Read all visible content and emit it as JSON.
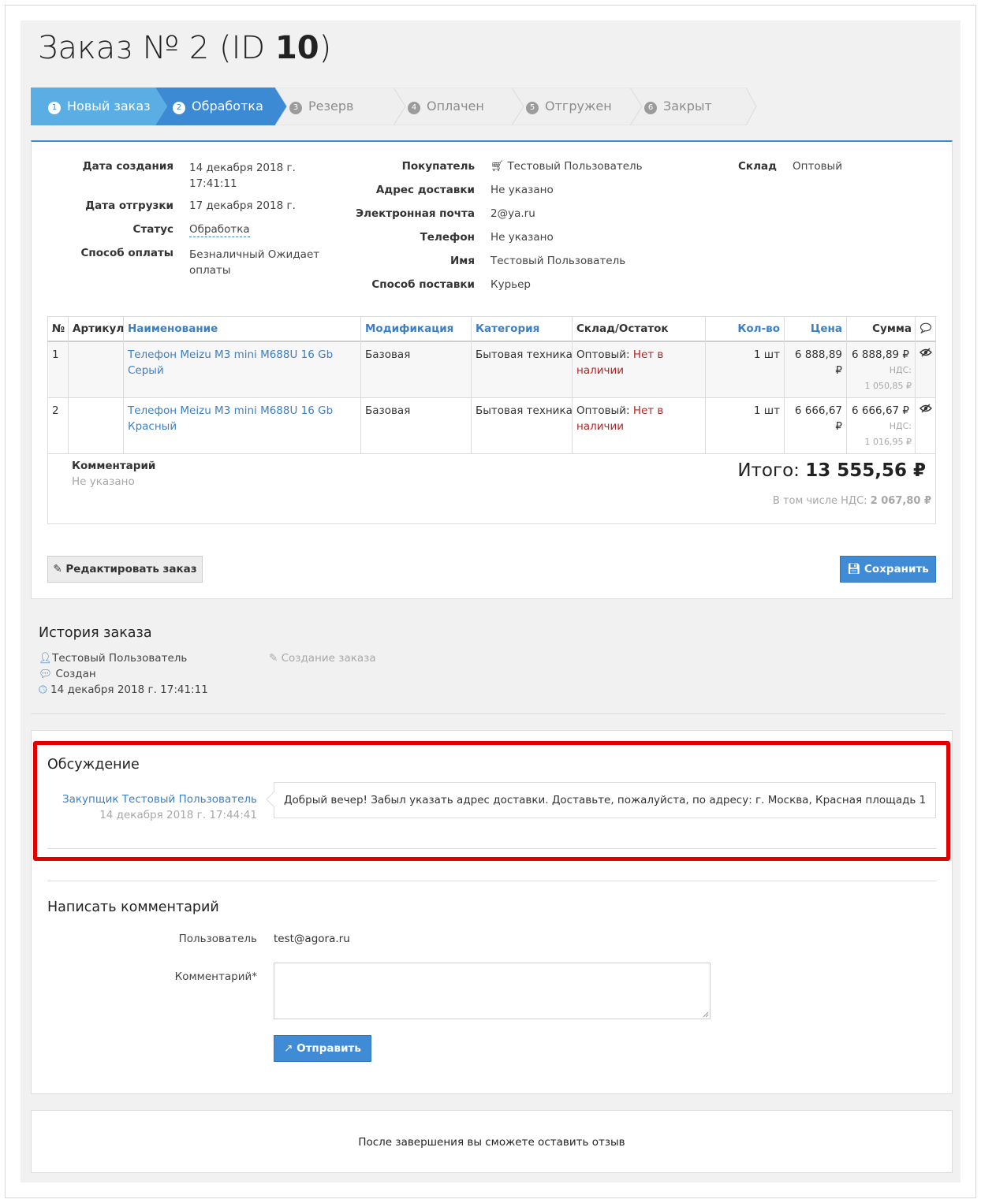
{
  "order": {
    "title_prefix": "Заказ № 2 (ID ",
    "title_id": "10",
    "title_suffix": ")"
  },
  "steps": [
    {
      "num": "1",
      "label": "Новый заказ"
    },
    {
      "num": "2",
      "label": "Обработка"
    },
    {
      "num": "3",
      "label": "Резерв"
    },
    {
      "num": "4",
      "label": "Оплачен"
    },
    {
      "num": "5",
      "label": "Отгружен"
    },
    {
      "num": "6",
      "label": "Закрыт"
    }
  ],
  "info": {
    "created_label": "Дата создания",
    "created_value_line1": "14 декабря 2018 г.",
    "created_value_line2": "17:41:11",
    "shipped_label": "Дата отгрузки",
    "shipped_value": "17 декабря 2018 г.",
    "status_label": "Статус",
    "status_value": "Обработка",
    "payment_label": "Способ оплаты",
    "payment_value_line1": "Безналичный Ожидает",
    "payment_value_line2": "оплаты",
    "buyer_label": "Покупатель",
    "buyer_value": "Тестовый Пользователь",
    "address_label": "Адрес доставки",
    "address_value": "Не указано",
    "email_label": "Электронная почта",
    "email_value": "2@ya.ru",
    "phone_label": "Телефон",
    "phone_value": "Не указано",
    "name_label": "Имя",
    "name_value": "Тестовый Пользователь",
    "delivery_label": "Способ поставки",
    "delivery_value": "Курьер",
    "warehouse_label": "Склад",
    "warehouse_value": "Оптовый"
  },
  "table": {
    "headers": {
      "num": "№",
      "sku": "Артикул",
      "name": "Наименование",
      "mod": "Модификация",
      "cat": "Категория",
      "stock": "Склад/Остаток",
      "qty": "Кол-во",
      "price": "Цена",
      "sum": "Сумма"
    },
    "rows": [
      {
        "num": "1",
        "name_line1": "Телефон Meizu M3 mini M688U 16 Gb",
        "name_line2": "Серый",
        "mod": "Базовая",
        "cat": "Бытовая техника",
        "stock_prefix": "Оптовый: ",
        "stock_line1": "Нет в",
        "stock_line2": "наличии",
        "qty": "1 шт",
        "price": "6 888,89 ₽",
        "sum": "6 888,89 ₽",
        "vat_label": "НДС:",
        "vat_value": "1 050,85 ₽"
      },
      {
        "num": "2",
        "name_line1": "Телефон Meizu M3 mini M688U 16 Gb",
        "name_line2": "Красный",
        "mod": "Базовая",
        "cat": "Бытовая техника",
        "stock_prefix": "Оптовый: ",
        "stock_line1": "Нет в",
        "stock_line2": "наличии",
        "qty": "1 шт",
        "price": "6 666,67 ₽",
        "sum": "6 666,67 ₽",
        "vat_label": "НДС:",
        "vat_value": "1 016,95 ₽"
      }
    ],
    "comment_label": "Комментарий",
    "comment_value": "Не указано",
    "total_label": "Итого: ",
    "total_value": "13 555,56 ₽",
    "vat_total_label": "В том числе НДС: ",
    "vat_total_value": "2 067,80 ₽"
  },
  "buttons": {
    "edit": "Редактировать заказ",
    "save": "Сохранить",
    "send": "Отправить"
  },
  "history": {
    "title": "История заказа",
    "user": "Тестовый Пользователь",
    "action": "Создан",
    "datetime": "14 декабря 2018 г. 17:41:11",
    "event": "Создание заказа"
  },
  "discussion": {
    "title": "Обсуждение",
    "author": "Закупщик Тестовый Пользователь",
    "date": "14 декабря 2018 г. 17:44:41",
    "message": "Добрый вечер! Забыл указать адрес доставки. Доставьте, пожалуйста, по адресу: г. Москва, Красная площадь 1"
  },
  "comment_form": {
    "title": "Написать комментарий",
    "user_label": "Пользователь",
    "user_value": "test@agora.ru",
    "comment_label": "Комментарий*"
  },
  "review_note": "После завершения вы сможете оставить отзыв",
  "colors": {
    "accent": "#3b8ad3",
    "highlight": "#e00000",
    "danger": "#b52424"
  }
}
